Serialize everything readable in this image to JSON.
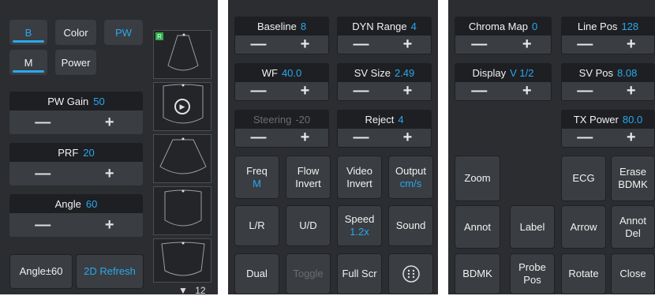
{
  "panel1": {
    "modes": {
      "b": "B",
      "color": "Color",
      "pw": "PW",
      "m": "M",
      "power": "Power"
    },
    "controls": [
      {
        "label": "PW Gain",
        "value": "50"
      },
      {
        "label": "PRF",
        "value": "20"
      },
      {
        "label": "Angle",
        "value": "60"
      }
    ],
    "buttons": {
      "angle": "Angle±60",
      "refresh": "2D Refresh"
    },
    "page_count": "12",
    "selected_badge": "R"
  },
  "panel2": {
    "controls": [
      {
        "label": "Baseline",
        "value": "8"
      },
      {
        "label": "DYN Range",
        "value": "4"
      },
      {
        "label": "WF",
        "value": "40.0"
      },
      {
        "label": "SV Size",
        "value": "2.49"
      },
      {
        "label": "Steering",
        "value": "-20"
      },
      {
        "label": "Reject",
        "value": "4"
      }
    ],
    "buttons": [
      {
        "label": "Freq",
        "sub": "M"
      },
      {
        "label": "Flow Invert",
        "sub": ""
      },
      {
        "label": "Video Invert",
        "sub": ""
      },
      {
        "label": "Output",
        "sub": "cm/s"
      },
      {
        "label": "L/R",
        "sub": ""
      },
      {
        "label": "U/D",
        "sub": ""
      },
      {
        "label": "Speed",
        "sub": "1.2x"
      },
      {
        "label": "Sound",
        "sub": ""
      },
      {
        "label": "Dual",
        "sub": ""
      },
      {
        "label": "Toggle",
        "sub": ""
      },
      {
        "label": "Full Scr",
        "sub": ""
      }
    ]
  },
  "panel3": {
    "controls": [
      {
        "label": "Chroma Map",
        "value": "0"
      },
      {
        "label": "Line Pos",
        "value": "128"
      },
      {
        "label": "Display",
        "value": "V 1/2"
      },
      {
        "label": "SV Pos",
        "value": "8.08"
      },
      {
        "label": "TX Power",
        "value": "80.0"
      }
    ],
    "buttons": {
      "zoom": "Zoom",
      "ecg": "ECG",
      "erase": "Erase BDMK",
      "annot": "Annot",
      "label": "Label",
      "arrow": "Arrow",
      "annot_del": "Annot Del",
      "bdmk": "BDMK",
      "probe_pos": "Probe Pos",
      "rotate": "Rotate",
      "close": "Close"
    }
  },
  "symbols": {
    "minus": "—",
    "plus": "+",
    "more_icon": "dots-grid-icon"
  }
}
